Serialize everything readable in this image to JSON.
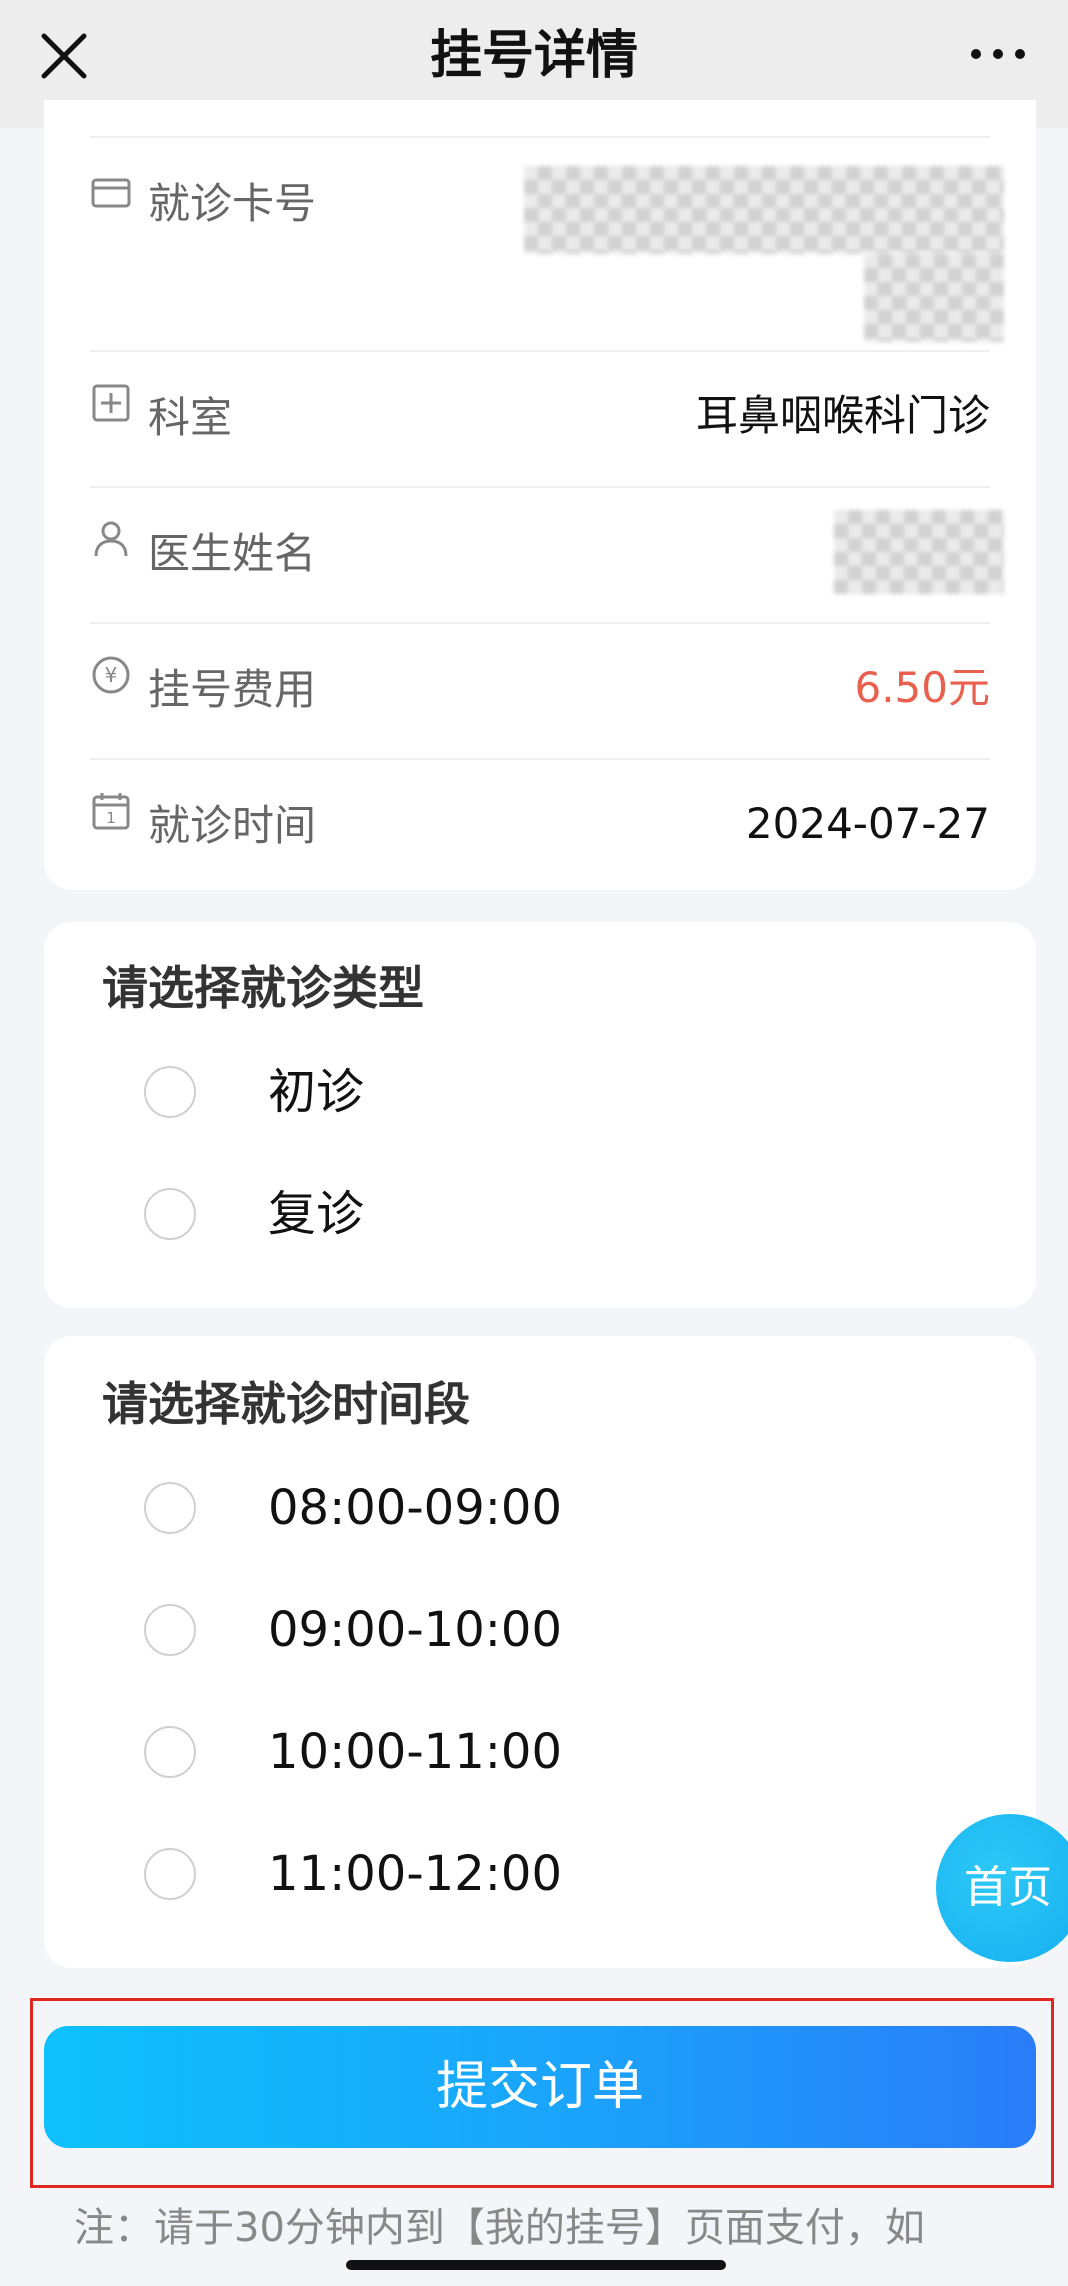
{
  "nav": {
    "title": "挂号详情",
    "close_icon": "close-icon",
    "more_icon": "more-icon"
  },
  "info": {
    "card_no": {
      "label": "就诊卡号",
      "icon": "card-icon"
    },
    "department": {
      "label": "科室",
      "value": "耳鼻咽喉科门诊",
      "icon": "plus-square-icon"
    },
    "doctor": {
      "label": "医生姓名",
      "icon": "doctor-icon"
    },
    "fee": {
      "label": "挂号费用",
      "value": "6.50元",
      "icon": "yen-icon"
    },
    "visit_time": {
      "label": "就诊时间",
      "value": "2024-07-27",
      "icon": "calendar-icon"
    }
  },
  "visit_type": {
    "title": "请选择就诊类型",
    "options": [
      "初诊",
      "复诊"
    ]
  },
  "time_slot": {
    "title": "请选择就诊时间段",
    "options": [
      "08:00-09:00",
      "09:00-10:00",
      "10:00-11:00",
      "11:00-12:00"
    ]
  },
  "home_button": "首页",
  "submit_button": "提交订单",
  "notice": "注：请于30分钟内到【我的挂号】页面支付，如",
  "colors": {
    "fee": "#e9604f",
    "accent_start": "#0ec1fb",
    "accent_end": "#2a7cf8",
    "highlight_border": "#e0271f"
  }
}
